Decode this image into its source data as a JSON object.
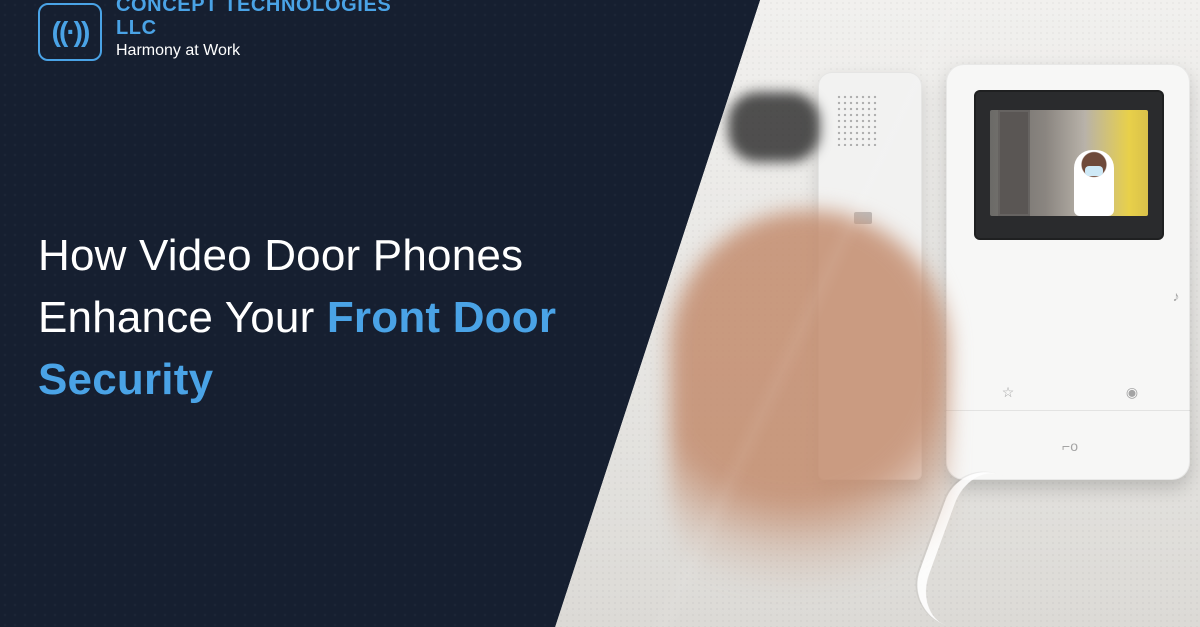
{
  "logo": {
    "brand": "CONCEPT TECHNOLOGIES LLC",
    "tagline": "Harmony at Work",
    "mark_icon": "signal-waves-icon"
  },
  "headline": {
    "line1": "How Video Door Phones",
    "line2_prefix": "Enhance Your ",
    "line2_accent": "Front Door",
    "line3_accent": "Security"
  },
  "colors": {
    "background": "#161f30",
    "accent": "#4aa3e6",
    "text": "#ffffff"
  }
}
